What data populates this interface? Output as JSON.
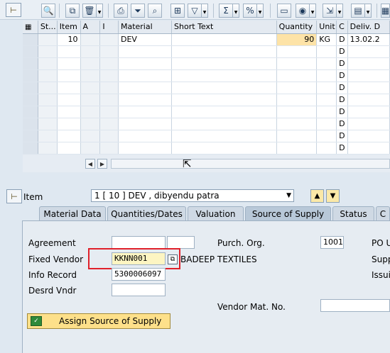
{
  "toolbar": {
    "icons": [
      "details-icon",
      "copy-icon",
      "delete-icon",
      "print-icon",
      "filter-icon",
      "find-icon",
      "find-next-icon",
      "set-filter-icon",
      "sum-icon",
      "subtotal-icon",
      "layout-icon",
      "view-icon",
      "export-icon",
      "columns-icon"
    ]
  },
  "grid": {
    "columns": [
      "St...",
      "Item",
      "A",
      "I",
      "Material",
      "Short Text",
      "Quantity",
      "Unit",
      "C",
      "Deliv. D"
    ],
    "rows": [
      {
        "st": "",
        "item": "10",
        "a": "",
        "i": "",
        "material": "DEV",
        "short_text": "",
        "quantity": "90",
        "unit": "KG",
        "c": "D",
        "deliv": "13.02.2"
      },
      {
        "c": "D"
      },
      {
        "c": "D"
      },
      {
        "c": "D"
      },
      {
        "c": "D"
      },
      {
        "c": "D"
      },
      {
        "c": "D"
      },
      {
        "c": "D"
      },
      {
        "c": "D"
      },
      {
        "c": "D"
      }
    ]
  },
  "item_header": {
    "label": "Item",
    "selected": "1 [ 10 ] DEV , dibyendu patra"
  },
  "tabs": [
    "Material Data",
    "Quantities/Dates",
    "Valuation",
    "Source of Supply",
    "Status",
    "C"
  ],
  "active_tab": "Source of Supply",
  "form": {
    "agreement_label": "Agreement",
    "agreement_value": "",
    "agreement_item": "",
    "fixed_vendor_label": "Fixed Vendor",
    "fixed_vendor_value": "KKNN001",
    "fixed_vendor_name": "BADEEP TEXTILES",
    "info_record_label": "Info Record",
    "info_record_value": "5300006097",
    "desrd_vndr_label": "Desrd Vndr",
    "desrd_vndr_value": "",
    "purch_org_label": "Purch. Org.",
    "purch_org_value": "1001",
    "po_unit_label": "PO U",
    "supplying_label": "Supp",
    "issuing_label": "Issui",
    "vendor_mat_label": "Vendor Mat. No.",
    "vendor_mat_value": "",
    "assign_button": "Assign Source of Supply"
  },
  "colors": {
    "background": "#dfe8f1",
    "quantity_highlight": "#fde3a7",
    "button_yellow": "#fde08a",
    "highlight_box": "#e0202a"
  }
}
